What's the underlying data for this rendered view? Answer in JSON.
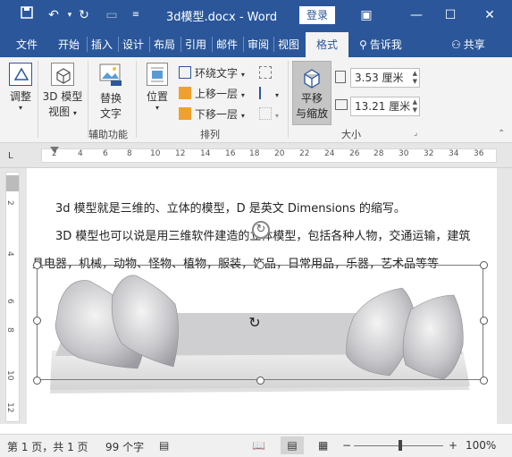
{
  "titlebar": {
    "doc_title": "3d模型.docx  -  Word",
    "login_label": "登录",
    "colors": {
      "brand": "#2b579a"
    }
  },
  "tabs": {
    "file": "文件",
    "home": "开始",
    "insert": "插入",
    "design": "设计",
    "layout": "布局",
    "references": "引用",
    "mailings": "邮件",
    "review": "审阅",
    "view": "视图",
    "format": "格式",
    "tell_me": "告诉我",
    "share": "共享"
  },
  "ribbon": {
    "adjust": "调整",
    "view3d_line1": "3D 模型",
    "view3d_line2": "视图",
    "alt_line1": "替换",
    "alt_line2": "文字",
    "accessibility_label": "辅助功能",
    "position": "位置",
    "wrap_text": "环绕文字",
    "bring_forward": "上移一层",
    "send_backward": "下移一层",
    "arrange_label": "排列",
    "pan_line1": "平移",
    "pan_line2": "与缩放",
    "height_value": "3.53 厘米",
    "width_value": "13.21 厘米",
    "size_label": "大小"
  },
  "ruler": {
    "h_ticks": [
      "2",
      "4",
      "6",
      "8",
      "10",
      "12",
      "14",
      "16",
      "18",
      "20",
      "22",
      "24",
      "26",
      "28",
      "30",
      "32",
      "34",
      "36"
    ],
    "v_ticks": [
      "2",
      "4",
      "6",
      "8",
      "10",
      "12"
    ],
    "h_ticks_prefix": "L"
  },
  "document": {
    "para1": "3d 模型就是三维的、立体的模型，D 是英文 Dimensions 的缩写。",
    "para2": "3D 模型也可以说是用三维软件建造的立体模型，包括各种人物，交通运输，建筑",
    "para3": "具电器，机械，动物、怪物、植物，服装，饰品，日常用品，乐器，艺术品等等"
  },
  "statusbar": {
    "page_info": "第 1 页，共 1 页",
    "word_count": "99 个字",
    "zoom": "100%"
  }
}
